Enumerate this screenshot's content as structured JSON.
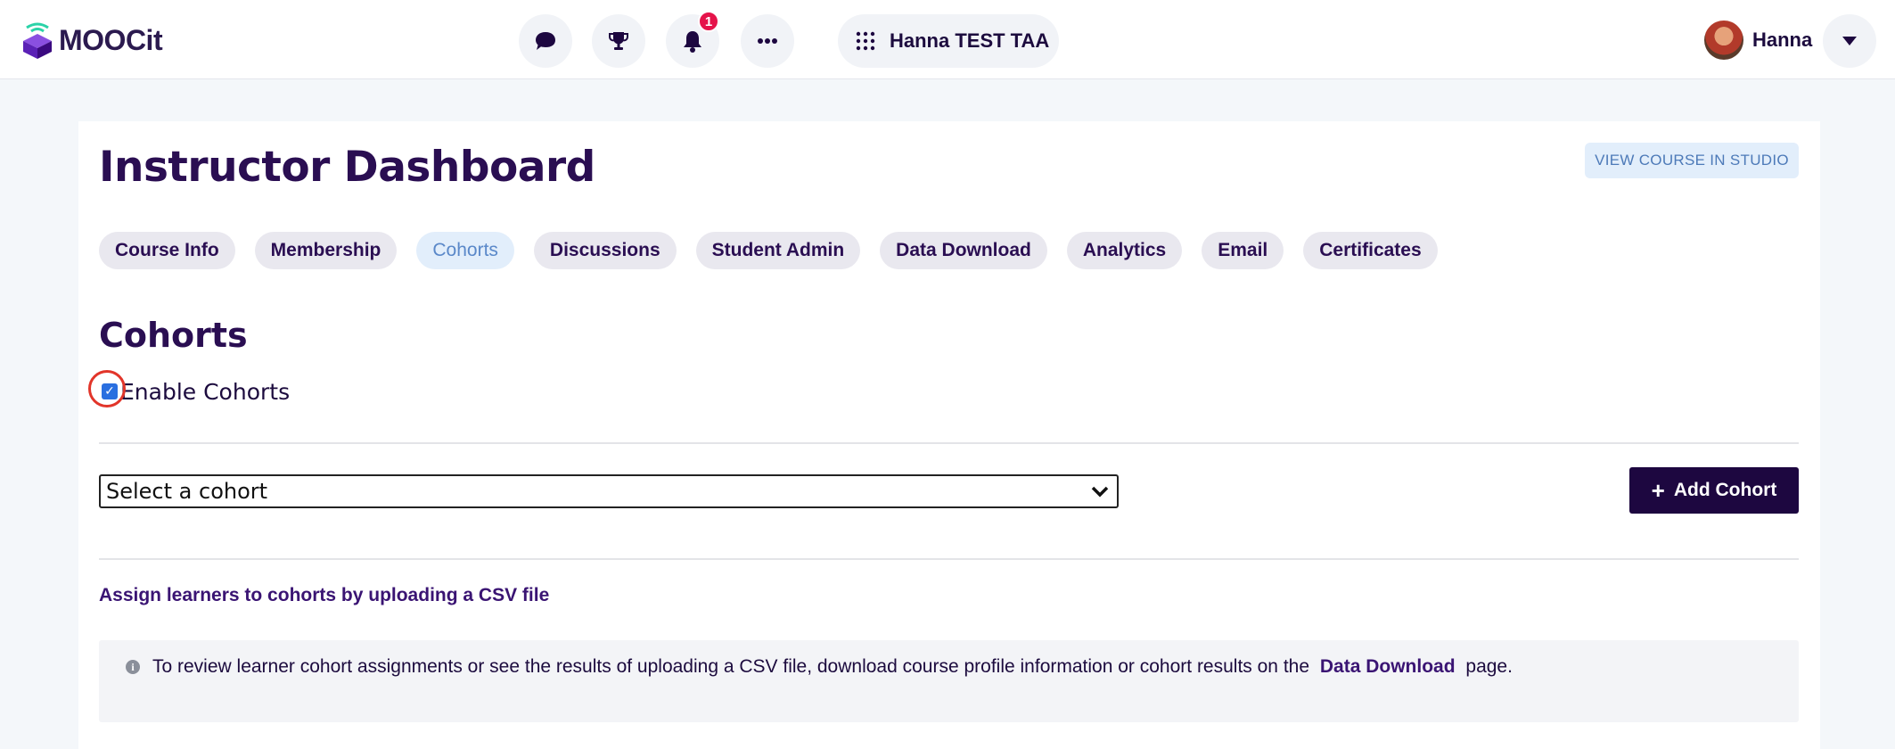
{
  "header": {
    "brand": "MOOCit",
    "notifications_count": "1",
    "course_name": "Hanna TEST TAA",
    "user_name": "Hanna",
    "icons": [
      "chat-icon",
      "trophy-icon",
      "bell-icon",
      "more-icon",
      "grid-icon",
      "chevron-down-icon"
    ]
  },
  "page": {
    "title": "Instructor Dashboard",
    "view_studio_label": "VIEW COURSE IN STUDIO"
  },
  "tabs": [
    {
      "label": "Course Info",
      "active": false
    },
    {
      "label": "Membership",
      "active": false
    },
    {
      "label": "Cohorts",
      "active": true
    },
    {
      "label": "Discussions",
      "active": false
    },
    {
      "label": "Student Admin",
      "active": false
    },
    {
      "label": "Data Download",
      "active": false
    },
    {
      "label": "Analytics",
      "active": false
    },
    {
      "label": "Email",
      "active": false
    },
    {
      "label": "Certificates",
      "active": false
    }
  ],
  "cohorts": {
    "section_title": "Cohorts",
    "enable_label": "Enable Cohorts",
    "enabled": true,
    "select_value": "Select a cohort",
    "add_label": "Add Cohort",
    "upload_link": "Assign learners to cohorts by uploading a CSV file",
    "info_before": "To review learner cohort assignments or see the results of uploading a CSV file, download course profile information or cohort results on the",
    "info_link": "Data Download",
    "info_after": "page."
  },
  "colors": {
    "brand_dark": "#1d0740",
    "title": "#2a0e52",
    "active_tab_bg": "#e2eefb",
    "active_tab_text": "#5a88c9",
    "badge": "#e5134a",
    "highlight_ring": "#e2352a"
  }
}
